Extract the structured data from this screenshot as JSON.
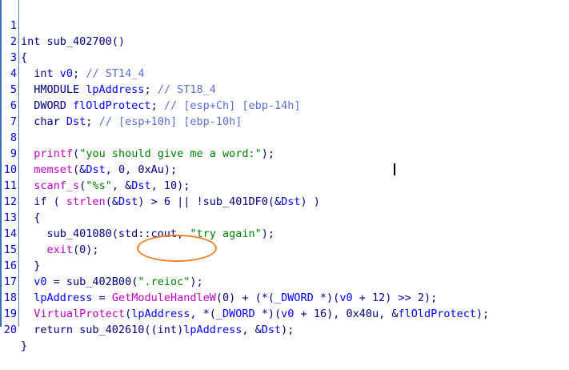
{
  "lines": [
    {
      "n": "1",
      "t": "int sub_402700()"
    },
    {
      "n": "2",
      "t": "{"
    },
    {
      "n": "3",
      "t": "  int v0; // ST14_4"
    },
    {
      "n": "4",
      "t": "  HMODULE lpAddress; // ST18_4"
    },
    {
      "n": "5",
      "t": "  DWORD flOldProtect; // [esp+Ch] [ebp-14h]"
    },
    {
      "n": "6",
      "t": "  char Dst; // [esp+10h] [ebp-10h]"
    },
    {
      "n": "7",
      "t": ""
    },
    {
      "n": "8",
      "t": "  printf(\"you should give me a word:\");"
    },
    {
      "n": "9",
      "t": "  memset(&Dst, 0, 0xAu);"
    },
    {
      "n": "10",
      "t": "  scanf_s(\"%s\", &Dst, 10);"
    },
    {
      "n": "11",
      "t": "  if ( strlen(&Dst) > 6 || !sub_401DF0(&Dst) )"
    },
    {
      "n": "12",
      "t": "  {"
    },
    {
      "n": "13",
      "t": "    sub_401080(std::cout, \"try again\");"
    },
    {
      "n": "14",
      "t": "    exit(0);"
    },
    {
      "n": "15",
      "t": "  }"
    },
    {
      "n": "16",
      "t": "  v0 = sub_402B00(\".reioc\");"
    },
    {
      "n": "17",
      "t": "  lpAddress = GetModuleHandleW(0) + (*(_DWORD *)(v0 + 12) >> 2);"
    },
    {
      "n": "18",
      "t": "  VirtualProtect(lpAddress, *(_DWORD *)(v0 + 16), 0x40u, &flOldProtect);"
    },
    {
      "n": "19",
      "t": "  return sub_402610((int)lpAddress, &Dst);"
    },
    {
      "n": "20",
      "t": "}"
    }
  ],
  "colors": {
    "line_number": "#0000c8",
    "code": "#000080",
    "string": "#008000",
    "comment": "#5a6fd0",
    "api_function": "#c000c0",
    "variable": "#0000ff",
    "highlight_ellipse": "#ef7f2a"
  }
}
